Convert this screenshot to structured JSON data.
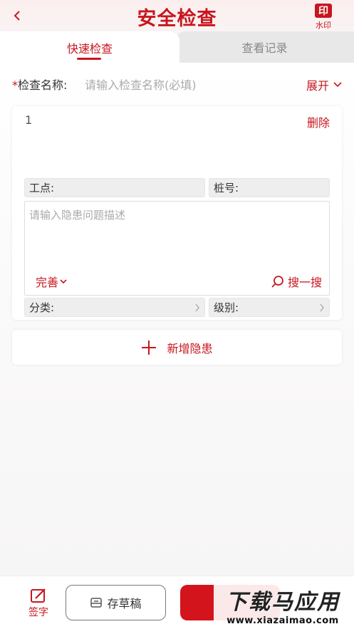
{
  "header": {
    "title": "安全检查",
    "watermark_icon": "印",
    "watermark_label": "水印"
  },
  "tabs": {
    "active": "快速检查",
    "inactive": "查看记录"
  },
  "name_row": {
    "required_mark": "*",
    "label": "检查名称:",
    "placeholder": "请输入检查名称(必填)",
    "expand_label": "展开"
  },
  "hazard_card": {
    "index": "1",
    "delete_label": "删除",
    "work_point_label": "工点:",
    "pile_label": "桩号:",
    "desc_placeholder": "请输入隐患问题描述",
    "perfect_label": "完善",
    "search_label": "搜一搜",
    "category_label": "分类:",
    "level_label": "级别:"
  },
  "add_hazard_label": "新增隐患",
  "bottom": {
    "sign_label": "签字",
    "draft_label": "存草稿"
  },
  "site_watermark": {
    "big": "下载马应用",
    "small": "www.xiazaimao.com"
  },
  "colors": {
    "accent": "#c8161e"
  }
}
